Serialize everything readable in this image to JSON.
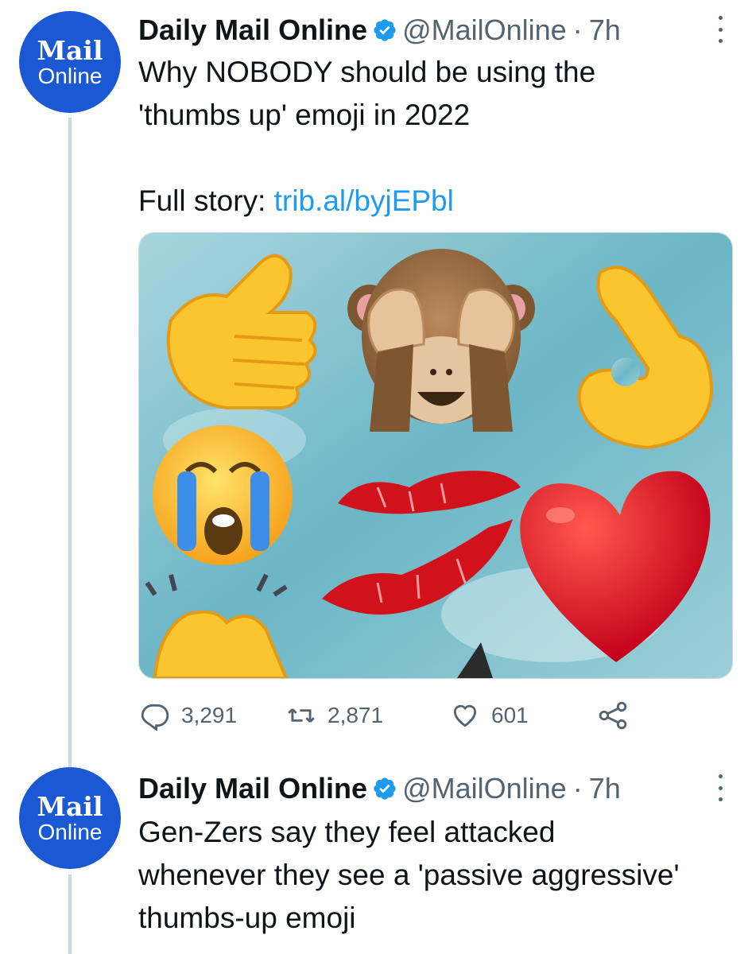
{
  "tweets": [
    {
      "avatar": {
        "line1": "Mail",
        "line2": "Online"
      },
      "name": "Daily Mail Online",
      "handle": "@MailOnline",
      "separator": "·",
      "time": "7h",
      "text_line1": "Why NOBODY should be using the",
      "text_line2": "'thumbs up' emoji in 2022",
      "story_label": "Full story: ",
      "story_link": "trib.al/byjEPbl",
      "stats": {
        "replies": "3,291",
        "retweets": "2,871",
        "likes": "601"
      }
    },
    {
      "avatar": {
        "line1": "Mail",
        "line2": "Online"
      },
      "name": "Daily Mail Online",
      "handle": "@MailOnline",
      "separator": "·",
      "time": "7h",
      "text_line1": "Gen-Zers say they feel attacked",
      "text_line2": "whenever they see a 'passive aggressive'",
      "text_line3": "thumbs-up emoji"
    }
  ],
  "media": {
    "emojis": [
      "thumbs-up",
      "see-no-evil-monkey",
      "ok-hand",
      "loudly-crying-face",
      "kiss-mark",
      "red-heart",
      "clapping-hands"
    ]
  },
  "colors": {
    "avatar_bg": "#1b58d4",
    "link": "#1d9bf0",
    "muted": "#536471",
    "verified": "#1d9bf0",
    "thread_line": "#cfd9de"
  }
}
